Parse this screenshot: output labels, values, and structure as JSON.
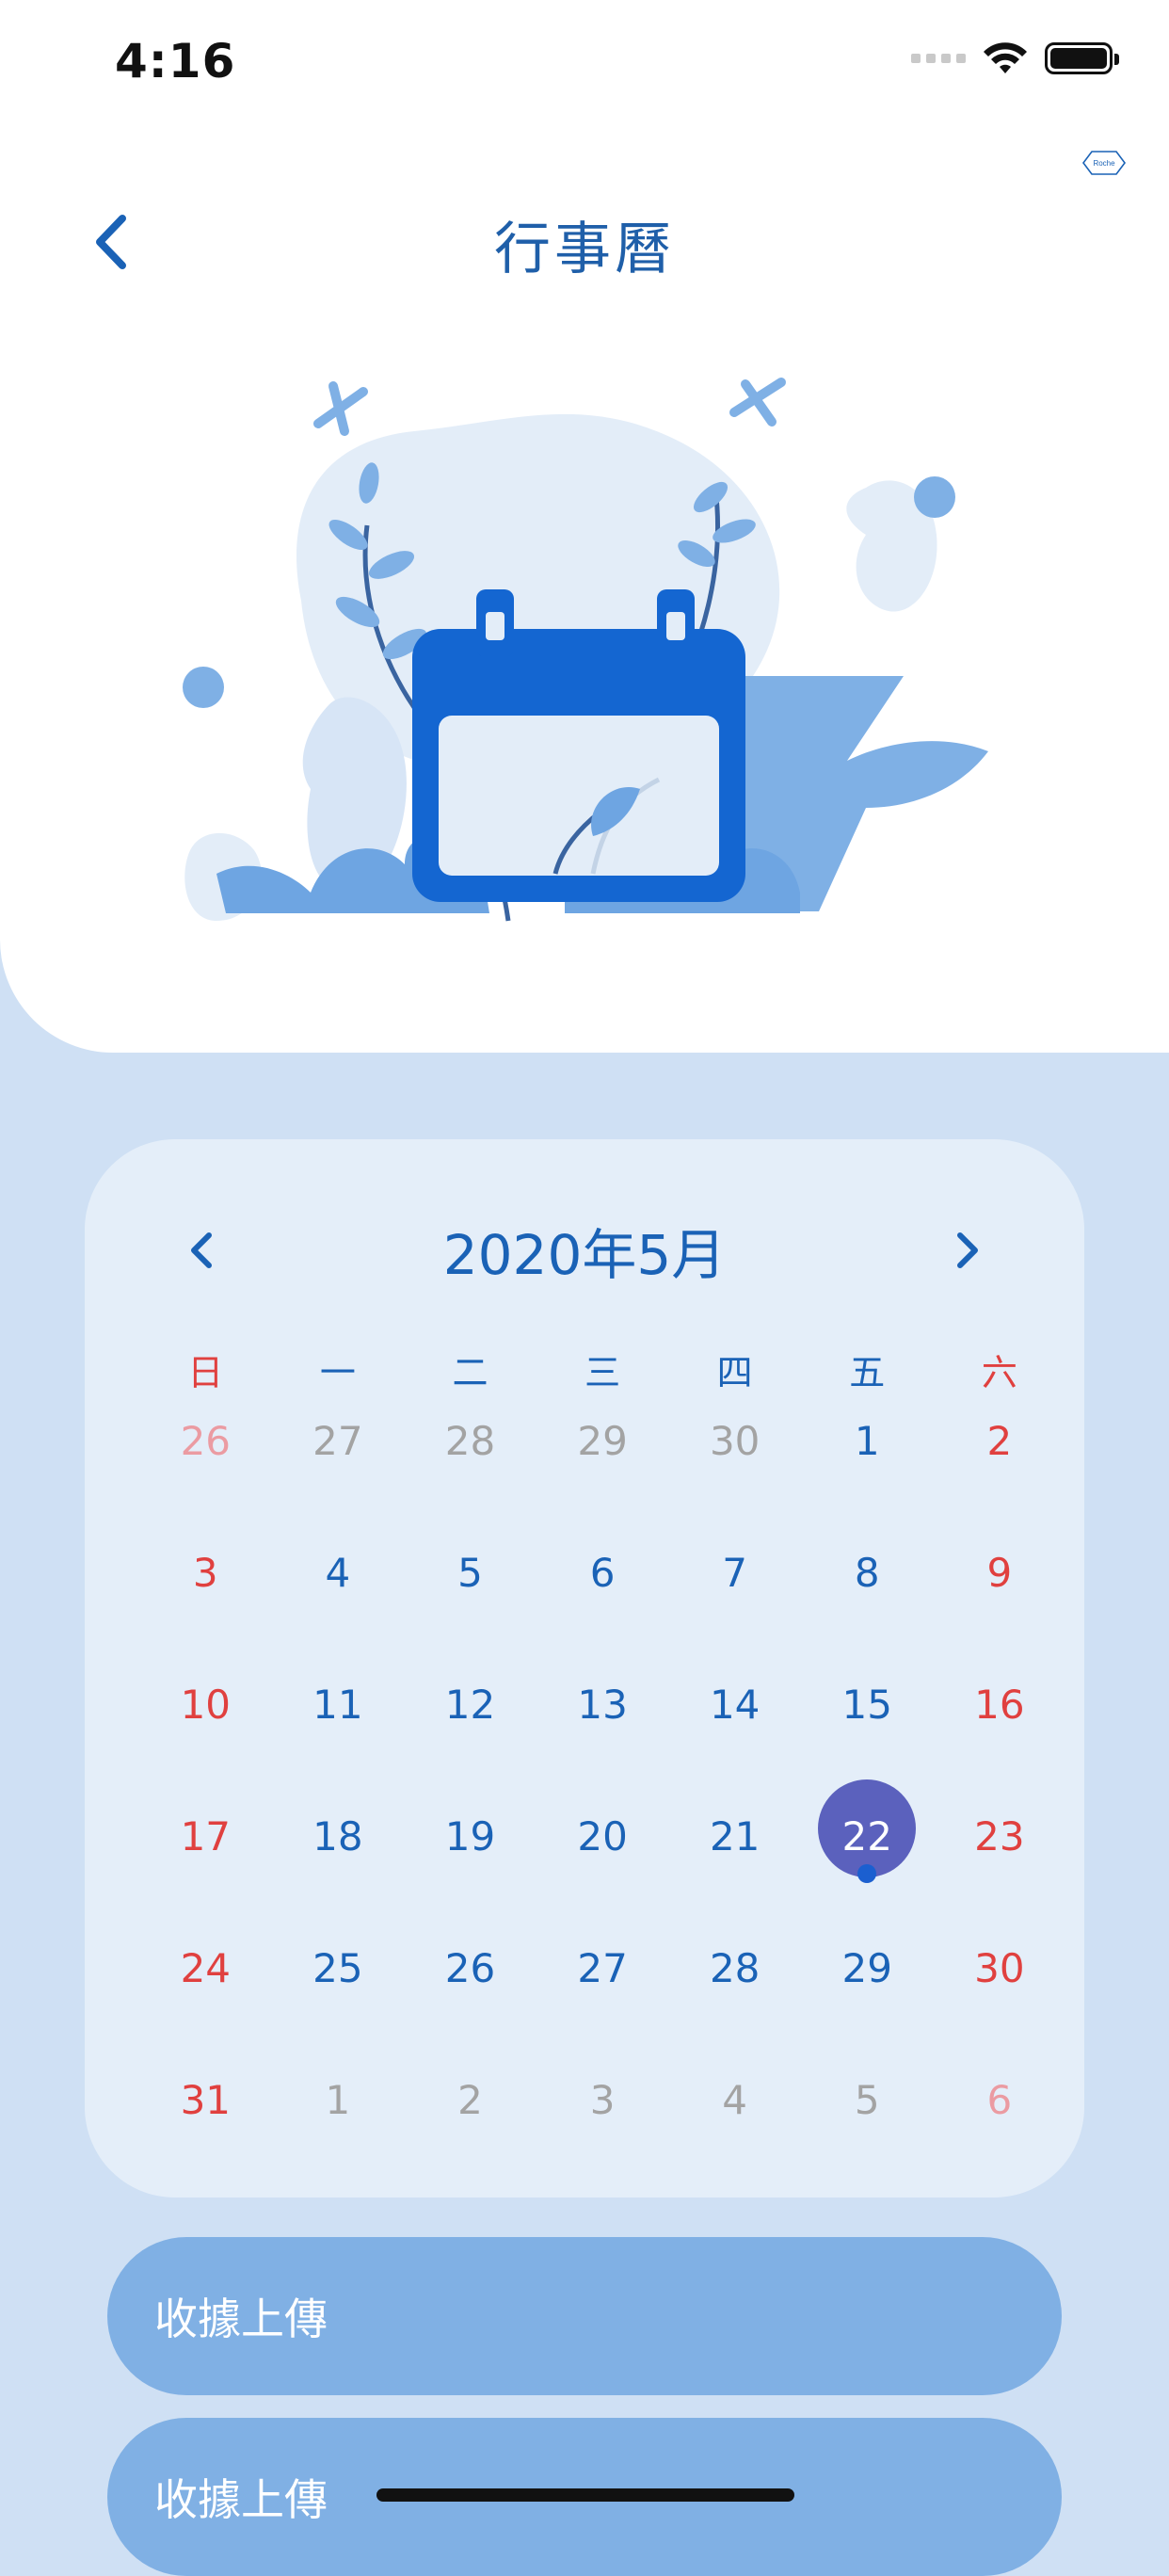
{
  "status_bar": {
    "time": "4:16"
  },
  "header": {
    "title": "行事曆",
    "brand": "Roche"
  },
  "calendar": {
    "month_title": "2020年5月",
    "weekdays": [
      "日",
      "一",
      "二",
      "三",
      "四",
      "五",
      "六"
    ],
    "weeks": [
      [
        "26",
        "27",
        "28",
        "29",
        "30",
        "1",
        "2"
      ],
      [
        "3",
        "4",
        "5",
        "6",
        "7",
        "8",
        "9"
      ],
      [
        "10",
        "11",
        "12",
        "13",
        "14",
        "15",
        "16"
      ],
      [
        "17",
        "18",
        "19",
        "20",
        "21",
        "22",
        "23"
      ],
      [
        "24",
        "25",
        "26",
        "27",
        "28",
        "29",
        "30"
      ],
      [
        "31",
        "1",
        "2",
        "3",
        "4",
        "5",
        "6"
      ]
    ],
    "selected_day": "22",
    "colors": {
      "weekday": "#1a62b6",
      "weekend": "#e0403f",
      "muted": "#a3a3a3",
      "selected": "#5b61bd"
    }
  },
  "actions": [
    {
      "label": "收據上傳"
    },
    {
      "label": "收據上傳"
    }
  ],
  "theme": {
    "primary": "#1a62b6",
    "background": "#cfe0f4",
    "button": "#80b0e4"
  }
}
